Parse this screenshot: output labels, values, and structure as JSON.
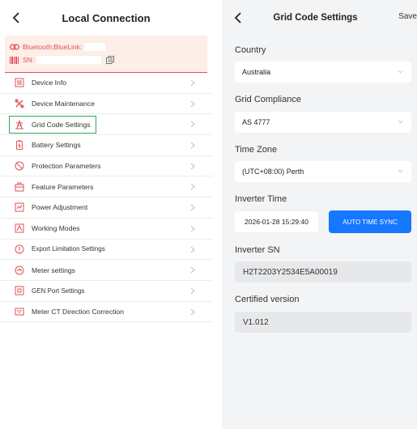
{
  "left": {
    "title": "Local Connection",
    "bluetooth_label": "Bluetooth:BlueLink:",
    "sn_label": "SN:",
    "menu": [
      {
        "label": "Device Info",
        "icon": "list-icon"
      },
      {
        "label": "Device Maintenance",
        "icon": "tools-icon"
      },
      {
        "label": "Grid Code Settings",
        "icon": "grid-tower-icon",
        "highlighted": true
      },
      {
        "label": "Battery Settings",
        "icon": "battery-icon"
      },
      {
        "label": "Protection Parameters",
        "icon": "shield-icon"
      },
      {
        "label": "Feature Parameters",
        "icon": "feature-icon"
      },
      {
        "label": "Power Adjustment",
        "icon": "power-adjust-icon"
      },
      {
        "label": "Working Modes",
        "icon": "mode-icon"
      },
      {
        "label": "Export Limitation Settings",
        "icon": "export-limit-icon"
      },
      {
        "label": "Meter settings",
        "icon": "meter-icon"
      },
      {
        "label": "GEN Port Settings",
        "icon": "gen-port-icon"
      },
      {
        "label": "Meter CT Direction Correction",
        "icon": "ct-direction-icon"
      }
    ]
  },
  "right": {
    "title": "Grid Code Settings",
    "save_label": "Save",
    "country_label": "Country",
    "country_value": "Australia",
    "grid_compliance_label": "Grid Compliance",
    "grid_compliance_value": "AS 4777",
    "time_zone_label": "Time Zone",
    "time_zone_value": "(UTC+08:00) Perth",
    "inverter_time_label": "Inverter Time",
    "inverter_time_value": "2026-01-28 15:29:40",
    "auto_sync_label": "AUTO TIME SYNC",
    "inverter_sn_label": "Inverter SN",
    "inverter_sn_value": "H2T2203Y2534E5A00019",
    "certified_version_label": "Certified version",
    "certified_version_value": "V1.012"
  },
  "colors": {
    "accent_red": "#e0505a",
    "highlight_green": "#2eaa5a",
    "button_blue": "#1677ff"
  }
}
